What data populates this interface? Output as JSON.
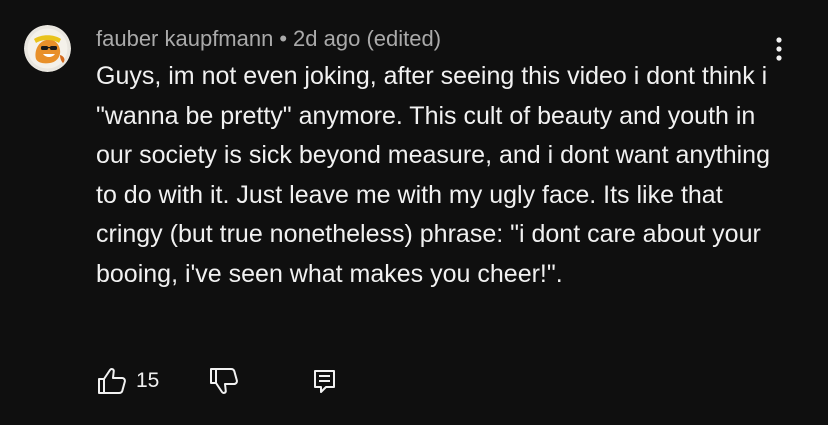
{
  "comment": {
    "author": "fauber kaupfmann",
    "separator": "•",
    "time": "2d ago (edited)",
    "body": "Guys, im not even joking, after seeing this video i dont think i \"wanna be pretty\" anymore. This cult of beauty and youth in our society is sick beyond measure, and i dont want anything to do with it. Just leave me with my ugly face. Its like that cringy (but true nonetheless) phrase: \"i dont care about your booing, i've seen what makes you cheer!\".",
    "like_count": "15",
    "avatar_icon": "cheetos-chester-avatar",
    "icons": {
      "like": "thumbs-up-icon",
      "dislike": "thumbs-down-icon",
      "reply": "reply-comment-icon",
      "more": "more-vertical-icon"
    }
  },
  "colors": {
    "background": "#0f0f0f",
    "text_primary": "#f1f1f1",
    "text_secondary": "#aaaaaa"
  }
}
